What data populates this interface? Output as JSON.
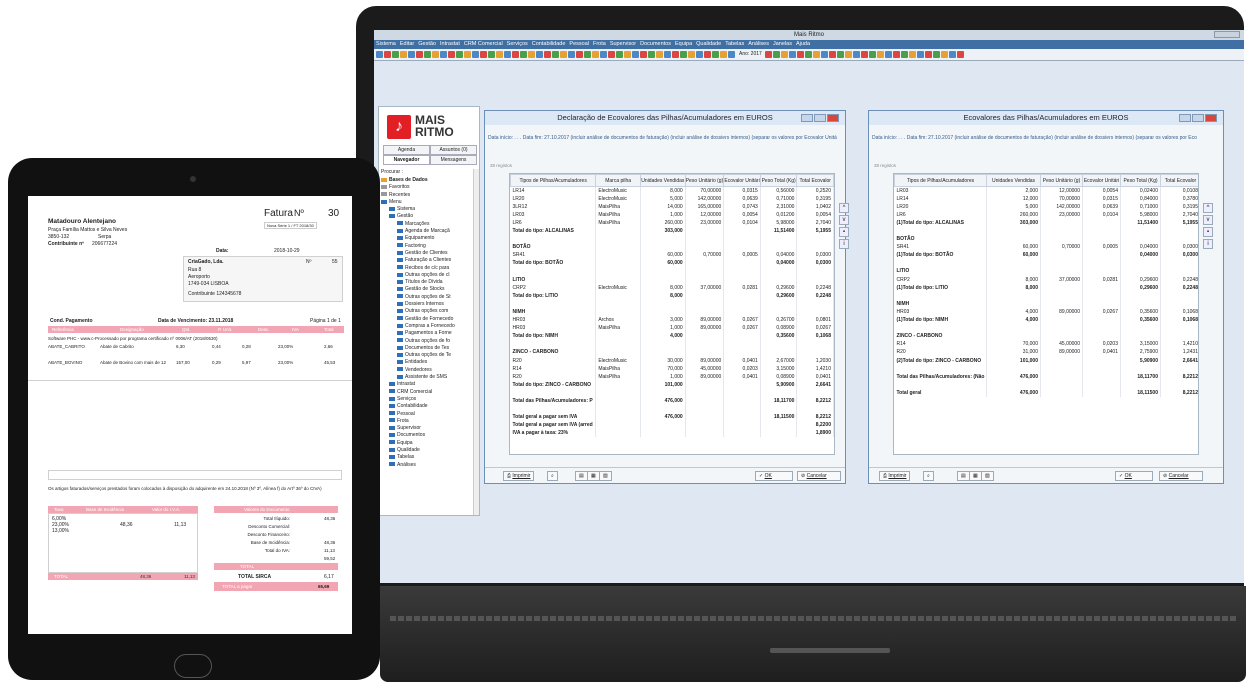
{
  "app": {
    "title": "Mais Ritmo",
    "menu": [
      "Sistema",
      "Editar",
      "Gestão",
      "Intrastat",
      "CRM Comercial",
      "Serviços",
      "Contabilidade",
      "Pessoal",
      "Frota",
      "Supervisor",
      "Documentos",
      "Equipa",
      "Qualidade",
      "Tabelas",
      "Análises",
      "Janelas",
      "Ajuda"
    ],
    "toolbar_year": "Ano: 2017",
    "colors": {
      "menubar": "#3f6fa3",
      "accent_red": "#e31f26",
      "pink": "#f2a6b4"
    }
  },
  "nav": {
    "logo_line1": "MAIS",
    "logo_line2": "RITMO",
    "tabs": [
      "Agenda",
      "Assuntos (0)",
      "Navegador",
      "Mensagens"
    ],
    "procurar": "Procurar :",
    "tree": [
      "Bases de Dados",
      "Favoritos",
      "Recentes",
      "Menu",
      "Sistema",
      "Gestão",
      "Marcações",
      "Agenda de Marcaçã",
      "Equipamento",
      "Factoring",
      "Gestão de Clientes",
      "Faturação a Clientes",
      "Recibos de c/c para",
      "Outras opções de cl",
      "Títulos de Dívida",
      "Gestão de Stocks",
      "Outras opções de St",
      "Dossiers Internos",
      "Outras opções com",
      "Gestão de Fornecedo",
      "Compras a Fornecedo",
      "Pagamentos a Forne",
      "Outras opções de fo",
      "Documentos de Tes",
      "Outras opções de Te",
      "Entidades",
      "Vendedores",
      "Assistente de SMS",
      "Intrastat",
      "CRM Comercial",
      "Serviços",
      "Contabilidade",
      "Pessoal",
      "Frota",
      "Supervisor",
      "Documentos",
      "Equipa",
      "Qualidade",
      "Tabelas",
      "Análises"
    ]
  },
  "win1": {
    "title": "Declaração de Ecovalores das Pilhas/Acumuladores em EUROS",
    "info": "Data início: . . .     Data fim: 27.10.2017 (incluir análise de documentos de faturação) (incluir análise de dossiers internos) (separar os valores por Ecovalor Unitá",
    "registos": "38 registos",
    "headers": [
      "Tipos de Pilhas/Acumuladores",
      "Marca pilha",
      "Unidades Vendidas",
      "Peso Unitário (g)",
      "Ecovalor Unitári",
      "Peso Total (Kg)",
      "Total Ecovalor"
    ],
    "rows": [
      [
        "LR14",
        "ElectroMusic",
        "8,000",
        "70,00000",
        "0,0315",
        "0,56000",
        "0,2520"
      ],
      [
        "LR20",
        "ElectroMusic",
        "5,000",
        "142,00000",
        "0,0639",
        "0,71000",
        "0,3195"
      ],
      [
        "3LR12",
        "MaisPilha",
        "14,000",
        "165,00000",
        "0,0743",
        "2,31000",
        "1,0402"
      ],
      [
        "LR03",
        "MaisPilha",
        "1,000",
        "12,00000",
        "0,0054",
        "0,01200",
        "0,0054"
      ],
      [
        "LR6",
        "MaisPilha",
        "260,000",
        "23,00000",
        "0,0104",
        "5,98000",
        "2,7040"
      ],
      [
        "Total do tipo: ALCALINAS",
        "",
        "303,000",
        "",
        "",
        "11,51400",
        "5,1955"
      ],
      [
        "",
        "",
        "",
        "",
        "",
        "",
        ""
      ],
      [
        "BOTÃO",
        "",
        "",
        "",
        "",
        "",
        ""
      ],
      [
        "SR41",
        "",
        "60,000",
        "0,70000",
        "0,0005",
        "0,04000",
        "0,0300"
      ],
      [
        "Total do tipo: BOTÃO",
        "",
        "60,000",
        "",
        "",
        "0,04000",
        "0,0300"
      ],
      [
        "",
        "",
        "",
        "",
        "",
        "",
        ""
      ],
      [
        "LITIO",
        "",
        "",
        "",
        "",
        "",
        ""
      ],
      [
        "CRP2",
        "ElectroMusic",
        "8,000",
        "37,00000",
        "0,0281",
        "0,29600",
        "0,2248"
      ],
      [
        "Total do tipo: LITIO",
        "",
        "8,000",
        "",
        "",
        "0,29600",
        "0,2248"
      ],
      [
        "",
        "",
        "",
        "",
        "",
        "",
        ""
      ],
      [
        "NIMH",
        "",
        "",
        "",
        "",
        "",
        ""
      ],
      [
        "HR03",
        "Archos",
        "3,000",
        "89,00000",
        "0,0267",
        "0,26700",
        "0,0801"
      ],
      [
        "HR03",
        "MaisPilha",
        "1,000",
        "89,00000",
        "0,0267",
        "0,08900",
        "0,0267"
      ],
      [
        "Total do tipo: NIMH",
        "",
        "4,000",
        "",
        "",
        "0,35600",
        "0,1068"
      ],
      [
        "",
        "",
        "",
        "",
        "",
        "",
        ""
      ],
      [
        "ZINCO - CARBONO",
        "",
        "",
        "",
        "",
        "",
        ""
      ],
      [
        "R20",
        "ElectroMusic",
        "30,000",
        "89,00000",
        "0,0401",
        "2,67000",
        "1,2030"
      ],
      [
        "R14",
        "MaisPilha",
        "70,000",
        "45,00000",
        "0,0203",
        "3,15000",
        "1,4210"
      ],
      [
        "R20",
        "MaisPilha",
        "1,000",
        "89,00000",
        "0,0401",
        "0,08900",
        "0,0401"
      ],
      [
        "Total do tipo: ZINCO - CARBONO",
        "",
        "101,000",
        "",
        "",
        "5,90900",
        "2,6641"
      ],
      [
        "",
        "",
        "",
        "",
        "",
        "",
        ""
      ],
      [
        "Total das Pilhas/Acumuladores: P",
        "",
        "476,000",
        "",
        "",
        "18,11700",
        "8,2212"
      ],
      [
        "",
        "",
        "",
        "",
        "",
        "",
        ""
      ],
      [
        "Total geral a pagar sem IVA",
        "",
        "476,000",
        "",
        "",
        "18,11500",
        "8,2212"
      ],
      [
        "Total geral a pagar sem IVA (arred",
        "",
        "",
        "",
        "",
        "",
        "8,2200"
      ],
      [
        "IVA a pagar à taxa: 23%",
        "",
        "",
        "",
        "",
        "",
        "1,8900"
      ]
    ],
    "bold_rows": [
      5,
      7,
      9,
      11,
      13,
      15,
      18,
      20,
      24,
      26,
      28,
      29,
      30
    ],
    "buttons": {
      "imprimir": "Imprimir",
      "ok": "OK",
      "cancelar": "Cancelar"
    }
  },
  "win2": {
    "title": "Ecovalores das Pilhas/Acumuladores em EUROS",
    "info": "Data início: . . .     Data fim: 27.10.2017 (incluir análise de documentos de faturação) (incluir análise de dossiers internos) (separar os valores por Eco",
    "registos": "38 registos",
    "headers": [
      "Tipos de Pilhas/Acumuladores",
      "Unidades Vendidas",
      "Peso Unitário (g)",
      "Ecovalor Unitári",
      "Peso Total (Kg)",
      "Total Ecovalor"
    ],
    "rows": [
      [
        "LR03",
        "2,000",
        "12,00000",
        "0,0054",
        "0,02400",
        "0,0108"
      ],
      [
        "LR14",
        "12,000",
        "70,00000",
        "0,0315",
        "0,84000",
        "0,3780"
      ],
      [
        "LR20",
        "5,000",
        "142,00000",
        "0,0639",
        "0,71000",
        "0,3195"
      ],
      [
        "LR6",
        "260,000",
        "23,00000",
        "0,0104",
        "5,98000",
        "2,7040"
      ],
      [
        "(1)Total do tipo: ALCALINAS",
        "303,000",
        "",
        "",
        "11,51400",
        "5,1955"
      ],
      [
        "",
        "",
        "",
        "",
        "",
        ""
      ],
      [
        "BOTÃO",
        "",
        "",
        "",
        "",
        ""
      ],
      [
        "SR41",
        "60,000",
        "0,70000",
        "0,0005",
        "0,04000",
        "0,0300"
      ],
      [
        "(1)Total do tipo: BOTÃO",
        "60,000",
        "",
        "",
        "0,04000",
        "0,0300"
      ],
      [
        "",
        "",
        "",
        "",
        "",
        ""
      ],
      [
        "LITIO",
        "",
        "",
        "",
        "",
        ""
      ],
      [
        "CRP2",
        "8,000",
        "37,00000",
        "0,0281",
        "0,29600",
        "0,2248"
      ],
      [
        "(1)Total do tipo: LITIO",
        "8,000",
        "",
        "",
        "0,29600",
        "0,2248"
      ],
      [
        "",
        "",
        "",
        "",
        "",
        ""
      ],
      [
        "NIMH",
        "",
        "",
        "",
        "",
        ""
      ],
      [
        "HR03",
        "4,000",
        "89,00000",
        "0,0267",
        "0,35600",
        "0,1068"
      ],
      [
        "(1)Total do tipo: NIMH",
        "4,000",
        "",
        "",
        "0,35600",
        "0,1068"
      ],
      [
        "",
        "",
        "",
        "",
        "",
        ""
      ],
      [
        "ZINCO - CARBONO",
        "",
        "",
        "",
        "",
        ""
      ],
      [
        "R14",
        "70,000",
        "45,00000",
        "0,0203",
        "3,15000",
        "1,4210"
      ],
      [
        "R20",
        "31,000",
        "89,00000",
        "0,0401",
        "2,75900",
        "1,2431"
      ],
      [
        "(2)Total do tipo: ZINCO - CARBONO",
        "101,000",
        "",
        "",
        "5,90900",
        "2,6641"
      ],
      [
        "",
        "",
        "",
        "",
        "",
        ""
      ],
      [
        "Total das Pilhas/Acumuladores: (Não",
        "476,000",
        "",
        "",
        "18,11700",
        "8,2212"
      ],
      [
        "",
        "",
        "",
        "",
        "",
        ""
      ],
      [
        "Total geral",
        "476,000",
        "",
        "",
        "18,11500",
        "8,2212"
      ]
    ],
    "bold_rows": [
      4,
      6,
      8,
      10,
      12,
      14,
      16,
      18,
      21,
      23,
      25
    ],
    "buttons": {
      "imprimir": "Imprimir",
      "ok": "OK",
      "cancelar": "Cancelar"
    }
  },
  "invoice": {
    "company": "Matadouro Alentejano",
    "addr1": "Praça Família Mattos e Silva Neves",
    "addr2": "3850-132",
    "city": "Serpa",
    "contrib_label": "Contribuinte nº",
    "contrib": "206677224",
    "doc_title": "Fatura",
    "doc_no_label": "Nº",
    "doc_no": "30",
    "serie_line": "Nova  Série  1 /  FT 2018/30",
    "data_label": "Data:",
    "data": "2018-10-29",
    "client_name": "CriaGado, Lda.",
    "client_no_label": "Nº",
    "client_no": "55",
    "client_addr1": "Rua 8",
    "client_addr2": "Aeroporto",
    "client_addr3": "1749-034 LISBOA",
    "client_contrib": "Contribuinte  124345678",
    "cond_label": "Cond. Pagamento",
    "venc": "Data de Vencimento: 23.11.2018",
    "pagina": "Página 1 de 1",
    "table_headers": [
      "Referência",
      "Designação",
      "Qtd.",
      "P. Unit.",
      "Desc.",
      "IVA",
      "Total"
    ],
    "software_line": "Software PHC - www.c-Processado por programa certificado nº 0006/AT (2018/0530)",
    "items": [
      {
        "ref": "ABATE_CABRITO",
        "des": "Abate de Cabrito",
        "qtd": "6,30",
        "pu": "0,44",
        "desc": "0,28",
        "iva": "23,00%",
        "total": "2,66"
      },
      {
        "ref": "ABATE_BOVINO",
        "des": "Abate de Bovino com mais de 12",
        "qtd": "157,00",
        "pu": "0,29",
        "desc": "5,97",
        "iva": "23,00%",
        "total": "45,53"
      }
    ],
    "disponibilidade": "Os artigos faturados/serviços prestados foram colocados à disposição do adquirente em   24.10.2018  (Nº 3º, Alínea f) do Artº 36º do CIVA)",
    "tax_headers": [
      "Taxa",
      "Base de Incidência",
      "Valor do I.V.A."
    ],
    "tax_rates": [
      "6,00%",
      "23,00%",
      "13,00%"
    ],
    "tax_base": "48,36",
    "tax_valor": "11,13",
    "tax_total_label": "TOTAL",
    "tax_total_base": "48,36",
    "tax_total_valor": "11,13",
    "valores_title": "Valores do Documento",
    "valores": [
      [
        "Total Ilíquido:",
        "48,36"
      ],
      [
        "Desconto Comercial:",
        ""
      ],
      [
        "Desconto Financeiro:",
        ""
      ],
      [
        "Base de Incidência:",
        "48,36"
      ],
      [
        "Total do IVA:",
        "11,13"
      ],
      [
        "",
        "59,52"
      ]
    ],
    "total_label": "TOTAL",
    "sirca_label": "TOTAL SIRCA",
    "sirca": "6,17",
    "pagar_label": "TOTAL a pagar",
    "pagar": "65,69"
  }
}
